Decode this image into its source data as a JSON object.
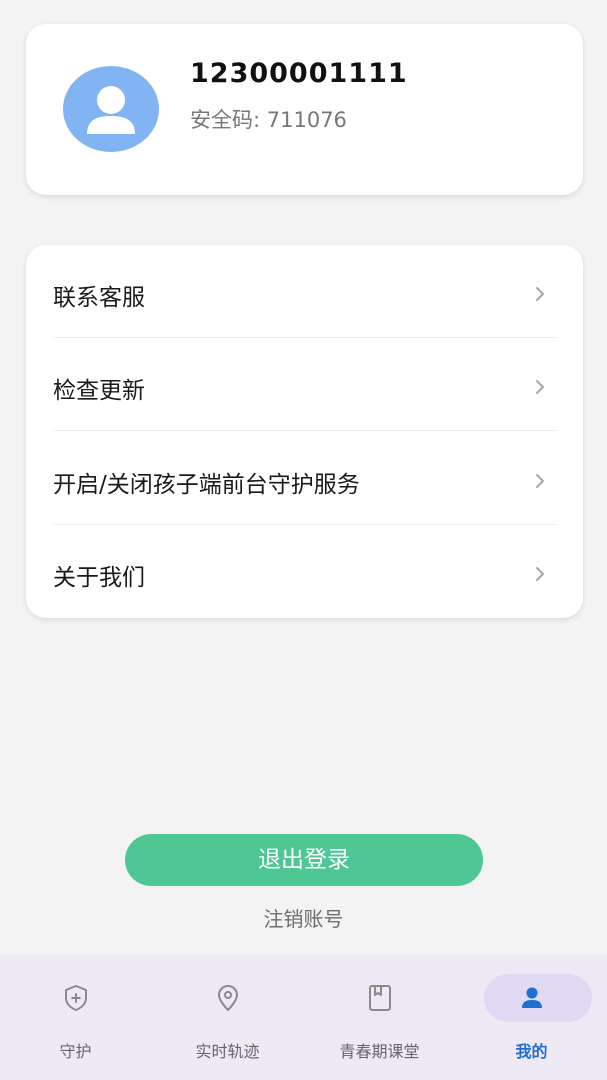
{
  "profile": {
    "phone": "12300001111",
    "security_code": "安全码: 711076"
  },
  "menu": {
    "items": [
      {
        "label": "联系客服"
      },
      {
        "label": "检查更新"
      },
      {
        "label": "开启/关闭孩子端前台守护服务"
      },
      {
        "label": "关于我们"
      }
    ]
  },
  "actions": {
    "logout_label": "退出登录",
    "deregister_label": "注销账号"
  },
  "tabbar": {
    "tabs": [
      {
        "label": "守护",
        "icon": "shield-plus-icon"
      },
      {
        "label": "实时轨迹",
        "icon": "location-pin-icon"
      },
      {
        "label": "青春期课堂",
        "icon": "book-icon"
      },
      {
        "label": "我的",
        "icon": "person-icon",
        "active": true
      }
    ]
  },
  "colors": {
    "accent_green": "#4fc793",
    "avatar_blue": "#82b4f3",
    "active_tab_blue": "#1f6fd1",
    "tabbar_bg": "#efe9f5"
  }
}
